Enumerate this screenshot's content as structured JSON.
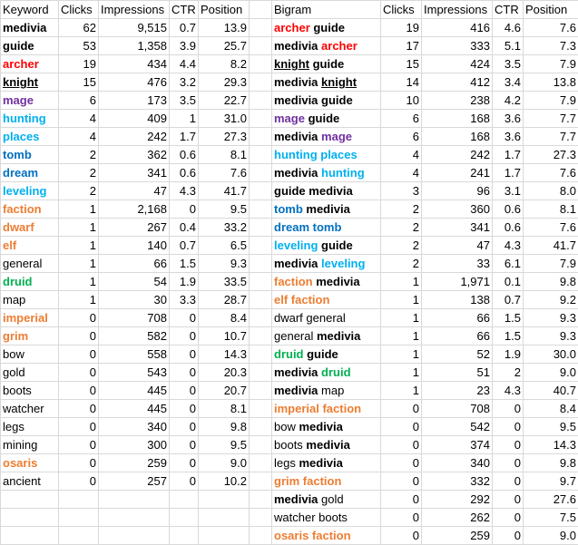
{
  "colors": {
    "red": "#ff0000",
    "purple": "#7030a0",
    "blue": "#00b0f0",
    "navy": "#0070c0",
    "orange": "#ed7d31",
    "green": "#00b050",
    "black": "#000000"
  },
  "keywords": {
    "headers": [
      "Keyword",
      "Clicks",
      "Impressions",
      "CTR",
      "Position"
    ],
    "rows": [
      {
        "k": [
          {
            "t": "medivia",
            "c": "black",
            "b": true
          }
        ],
        "clicks": "62",
        "impr": "9,515",
        "ctr": "0.7",
        "pos": "13.9"
      },
      {
        "k": [
          {
            "t": "guide",
            "c": "black",
            "b": true
          }
        ],
        "clicks": "53",
        "impr": "1,358",
        "ctr": "3.9",
        "pos": "25.7"
      },
      {
        "k": [
          {
            "t": "archer",
            "c": "red",
            "b": true
          }
        ],
        "clicks": "19",
        "impr": "434",
        "ctr": "4.4",
        "pos": "8.2"
      },
      {
        "k": [
          {
            "t": "knight",
            "c": "black",
            "b": true,
            "u": true
          }
        ],
        "clicks": "15",
        "impr": "476",
        "ctr": "3.2",
        "pos": "29.3"
      },
      {
        "k": [
          {
            "t": "mage",
            "c": "purple",
            "b": true
          }
        ],
        "clicks": "6",
        "impr": "173",
        "ctr": "3.5",
        "pos": "22.7"
      },
      {
        "k": [
          {
            "t": "hunting",
            "c": "blue",
            "b": true
          }
        ],
        "clicks": "4",
        "impr": "409",
        "ctr": "1",
        "pos": "31.0"
      },
      {
        "k": [
          {
            "t": "places",
            "c": "blue",
            "b": true
          }
        ],
        "clicks": "4",
        "impr": "242",
        "ctr": "1.7",
        "pos": "27.3"
      },
      {
        "k": [
          {
            "t": "tomb",
            "c": "navy",
            "b": true
          }
        ],
        "clicks": "2",
        "impr": "362",
        "ctr": "0.6",
        "pos": "8.1"
      },
      {
        "k": [
          {
            "t": "dream",
            "c": "navy",
            "b": true
          }
        ],
        "clicks": "2",
        "impr": "341",
        "ctr": "0.6",
        "pos": "7.6"
      },
      {
        "k": [
          {
            "t": "leveling",
            "c": "blue",
            "b": true
          }
        ],
        "clicks": "2",
        "impr": "47",
        "ctr": "4.3",
        "pos": "41.7"
      },
      {
        "k": [
          {
            "t": "faction",
            "c": "orange",
            "b": true
          }
        ],
        "clicks": "1",
        "impr": "2,168",
        "ctr": "0",
        "pos": "9.5"
      },
      {
        "k": [
          {
            "t": "dwarf",
            "c": "orange",
            "b": true
          }
        ],
        "clicks": "1",
        "impr": "267",
        "ctr": "0.4",
        "pos": "33.2"
      },
      {
        "k": [
          {
            "t": "elf",
            "c": "orange",
            "b": true
          }
        ],
        "clicks": "1",
        "impr": "140",
        "ctr": "0.7",
        "pos": "6.5"
      },
      {
        "k": [
          {
            "t": "general",
            "c": "black",
            "b": false
          }
        ],
        "clicks": "1",
        "impr": "66",
        "ctr": "1.5",
        "pos": "9.3"
      },
      {
        "k": [
          {
            "t": "druid",
            "c": "green",
            "b": true
          }
        ],
        "clicks": "1",
        "impr": "54",
        "ctr": "1.9",
        "pos": "33.5"
      },
      {
        "k": [
          {
            "t": "map",
            "c": "black",
            "b": false
          }
        ],
        "clicks": "1",
        "impr": "30",
        "ctr": "3.3",
        "pos": "28.7"
      },
      {
        "k": [
          {
            "t": "imperial",
            "c": "orange",
            "b": true
          }
        ],
        "clicks": "0",
        "impr": "708",
        "ctr": "0",
        "pos": "8.4"
      },
      {
        "k": [
          {
            "t": "grim",
            "c": "orange",
            "b": true
          }
        ],
        "clicks": "0",
        "impr": "582",
        "ctr": "0",
        "pos": "10.7"
      },
      {
        "k": [
          {
            "t": "bow",
            "c": "black",
            "b": false
          }
        ],
        "clicks": "0",
        "impr": "558",
        "ctr": "0",
        "pos": "14.3"
      },
      {
        "k": [
          {
            "t": "gold",
            "c": "black",
            "b": false
          }
        ],
        "clicks": "0",
        "impr": "543",
        "ctr": "0",
        "pos": "20.3"
      },
      {
        "k": [
          {
            "t": "boots",
            "c": "black",
            "b": false
          }
        ],
        "clicks": "0",
        "impr": "445",
        "ctr": "0",
        "pos": "20.7"
      },
      {
        "k": [
          {
            "t": "watcher",
            "c": "black",
            "b": false
          }
        ],
        "clicks": "0",
        "impr": "445",
        "ctr": "0",
        "pos": "8.1"
      },
      {
        "k": [
          {
            "t": "legs",
            "c": "black",
            "b": false
          }
        ],
        "clicks": "0",
        "impr": "340",
        "ctr": "0",
        "pos": "9.8"
      },
      {
        "k": [
          {
            "t": "mining",
            "c": "black",
            "b": false
          }
        ],
        "clicks": "0",
        "impr": "300",
        "ctr": "0",
        "pos": "9.5"
      },
      {
        "k": [
          {
            "t": "osaris",
            "c": "orange",
            "b": true
          }
        ],
        "clicks": "0",
        "impr": "259",
        "ctr": "0",
        "pos": "9.0"
      },
      {
        "k": [
          {
            "t": "ancient",
            "c": "black",
            "b": false
          }
        ],
        "clicks": "0",
        "impr": "257",
        "ctr": "0",
        "pos": "10.2"
      }
    ]
  },
  "bigrams": {
    "headers": [
      "Bigram",
      "Clicks",
      "Impressions",
      "CTR",
      "Position"
    ],
    "rows": [
      {
        "k": [
          {
            "t": "archer",
            "c": "red",
            "b": true
          },
          {
            "t": " guide",
            "c": "black",
            "b": true
          }
        ],
        "clicks": "19",
        "impr": "416",
        "ctr": "4.6",
        "pos": "7.6"
      },
      {
        "k": [
          {
            "t": "medivia ",
            "c": "black",
            "b": true
          },
          {
            "t": "archer",
            "c": "red",
            "b": true
          }
        ],
        "clicks": "17",
        "impr": "333",
        "ctr": "5.1",
        "pos": "7.3"
      },
      {
        "k": [
          {
            "t": "knight",
            "c": "black",
            "b": true,
            "u": true
          },
          {
            "t": " guide",
            "c": "black",
            "b": true
          }
        ],
        "clicks": "15",
        "impr": "424",
        "ctr": "3.5",
        "pos": "7.9"
      },
      {
        "k": [
          {
            "t": "medivia ",
            "c": "black",
            "b": true
          },
          {
            "t": "knight",
            "c": "black",
            "b": true,
            "u": true
          }
        ],
        "clicks": "14",
        "impr": "412",
        "ctr": "3.4",
        "pos": "13.8"
      },
      {
        "k": [
          {
            "t": "medivia guide",
            "c": "black",
            "b": true
          }
        ],
        "clicks": "10",
        "impr": "238",
        "ctr": "4.2",
        "pos": "7.9"
      },
      {
        "k": [
          {
            "t": "mage",
            "c": "purple",
            "b": true
          },
          {
            "t": " guide",
            "c": "black",
            "b": true
          }
        ],
        "clicks": "6",
        "impr": "168",
        "ctr": "3.6",
        "pos": "7.7"
      },
      {
        "k": [
          {
            "t": "medivia ",
            "c": "black",
            "b": true
          },
          {
            "t": "mage",
            "c": "purple",
            "b": true
          }
        ],
        "clicks": "6",
        "impr": "168",
        "ctr": "3.6",
        "pos": "7.7"
      },
      {
        "k": [
          {
            "t": "hunting places",
            "c": "blue",
            "b": true
          }
        ],
        "clicks": "4",
        "impr": "242",
        "ctr": "1.7",
        "pos": "27.3"
      },
      {
        "k": [
          {
            "t": "medivia ",
            "c": "black",
            "b": true
          },
          {
            "t": "hunting",
            "c": "blue",
            "b": true
          }
        ],
        "clicks": "4",
        "impr": "241",
        "ctr": "1.7",
        "pos": "7.6"
      },
      {
        "k": [
          {
            "t": "guide medivia",
            "c": "black",
            "b": true
          }
        ],
        "clicks": "3",
        "impr": "96",
        "ctr": "3.1",
        "pos": "8.0"
      },
      {
        "k": [
          {
            "t": "tomb",
            "c": "navy",
            "b": true
          },
          {
            "t": " medivia",
            "c": "black",
            "b": true
          }
        ],
        "clicks": "2",
        "impr": "360",
        "ctr": "0.6",
        "pos": "8.1"
      },
      {
        "k": [
          {
            "t": "dream tomb",
            "c": "navy",
            "b": true
          }
        ],
        "clicks": "2",
        "impr": "341",
        "ctr": "0.6",
        "pos": "7.6"
      },
      {
        "k": [
          {
            "t": "leveling",
            "c": "blue",
            "b": true
          },
          {
            "t": " guide",
            "c": "black",
            "b": true
          }
        ],
        "clicks": "2",
        "impr": "47",
        "ctr": "4.3",
        "pos": "41.7"
      },
      {
        "k": [
          {
            "t": "medivia ",
            "c": "black",
            "b": true
          },
          {
            "t": "leveling",
            "c": "blue",
            "b": true
          }
        ],
        "clicks": "2",
        "impr": "33",
        "ctr": "6.1",
        "pos": "7.9"
      },
      {
        "k": [
          {
            "t": "faction",
            "c": "orange",
            "b": true
          },
          {
            "t": " medivia",
            "c": "black",
            "b": true
          }
        ],
        "clicks": "1",
        "impr": "1,971",
        "ctr": "0.1",
        "pos": "9.8"
      },
      {
        "k": [
          {
            "t": "elf faction",
            "c": "orange",
            "b": true
          }
        ],
        "clicks": "1",
        "impr": "138",
        "ctr": "0.7",
        "pos": "9.2"
      },
      {
        "k": [
          {
            "t": "dwarf general",
            "c": "black",
            "b": false
          }
        ],
        "clicks": "1",
        "impr": "66",
        "ctr": "1.5",
        "pos": "9.3"
      },
      {
        "k": [
          {
            "t": "general ",
            "c": "black",
            "b": false
          },
          {
            "t": "medivia",
            "c": "black",
            "b": true
          }
        ],
        "clicks": "1",
        "impr": "66",
        "ctr": "1.5",
        "pos": "9.3"
      },
      {
        "k": [
          {
            "t": "druid",
            "c": "green",
            "b": true
          },
          {
            "t": " guide",
            "c": "black",
            "b": true
          }
        ],
        "clicks": "1",
        "impr": "52",
        "ctr": "1.9",
        "pos": "30.0"
      },
      {
        "k": [
          {
            "t": "medivia ",
            "c": "black",
            "b": true
          },
          {
            "t": "druid",
            "c": "green",
            "b": true
          }
        ],
        "clicks": "1",
        "impr": "51",
        "ctr": "2",
        "pos": "9.0"
      },
      {
        "k": [
          {
            "t": "medivia",
            "c": "black",
            "b": true
          },
          {
            "t": " map",
            "c": "black",
            "b": false
          }
        ],
        "clicks": "1",
        "impr": "23",
        "ctr": "4.3",
        "pos": "40.7"
      },
      {
        "k": [
          {
            "t": "imperial faction",
            "c": "orange",
            "b": true
          }
        ],
        "clicks": "0",
        "impr": "708",
        "ctr": "0",
        "pos": "8.4"
      },
      {
        "k": [
          {
            "t": "bow ",
            "c": "black",
            "b": false
          },
          {
            "t": "medivia",
            "c": "black",
            "b": true
          }
        ],
        "clicks": "0",
        "impr": "542",
        "ctr": "0",
        "pos": "9.5"
      },
      {
        "k": [
          {
            "t": "boots ",
            "c": "black",
            "b": false
          },
          {
            "t": "medivia",
            "c": "black",
            "b": true
          }
        ],
        "clicks": "0",
        "impr": "374",
        "ctr": "0",
        "pos": "14.3"
      },
      {
        "k": [
          {
            "t": "legs ",
            "c": "black",
            "b": false
          },
          {
            "t": "medivia",
            "c": "black",
            "b": true
          }
        ],
        "clicks": "0",
        "impr": "340",
        "ctr": "0",
        "pos": "9.8"
      },
      {
        "k": [
          {
            "t": "grim faction",
            "c": "orange",
            "b": true
          }
        ],
        "clicks": "0",
        "impr": "332",
        "ctr": "0",
        "pos": "9.7"
      },
      {
        "k": [
          {
            "t": "medivia",
            "c": "black",
            "b": true
          },
          {
            "t": " gold",
            "c": "black",
            "b": false
          }
        ],
        "clicks": "0",
        "impr": "292",
        "ctr": "0",
        "pos": "27.6"
      },
      {
        "k": [
          {
            "t": "watcher boots",
            "c": "black",
            "b": false
          }
        ],
        "clicks": "0",
        "impr": "262",
        "ctr": "0",
        "pos": "7.5"
      },
      {
        "k": [
          {
            "t": "osaris faction",
            "c": "orange",
            "b": true
          }
        ],
        "clicks": "0",
        "impr": "259",
        "ctr": "0",
        "pos": "9.0"
      }
    ]
  }
}
